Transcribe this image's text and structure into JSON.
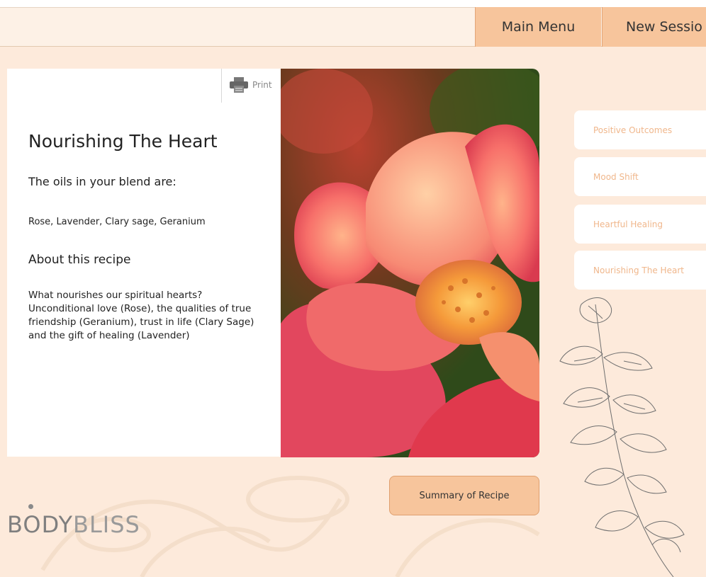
{
  "nav": {
    "main_menu": "Main Menu",
    "new_session": "New Sessio"
  },
  "print": {
    "label": "Print"
  },
  "recipe": {
    "title": "Nourishing The Heart",
    "oils_heading": "The oils in your blend are:",
    "oils": "Rose, Lavender, Clary sage, Geranium",
    "about_heading": "About this recipe",
    "description": "What nourishes our spiritual hearts? Unconditional love (Rose), the qualities of true friendship (Geranium), trust in life (Clary Sage) and the gift of healing (Lavender)"
  },
  "side_menu": {
    "items": [
      {
        "label": "Positive Outcomes"
      },
      {
        "label": "Mood Shift"
      },
      {
        "label": "Heartful Healing"
      },
      {
        "label": "Nourishing The Heart"
      }
    ]
  },
  "summary_button": {
    "label": "Summary of Recipe"
  },
  "brand": {
    "part1": "BODY",
    "part2": "BLISS"
  },
  "colors": {
    "accent": "#f7c59c",
    "background": "#fdeadb",
    "side_text": "#f0b78c"
  }
}
